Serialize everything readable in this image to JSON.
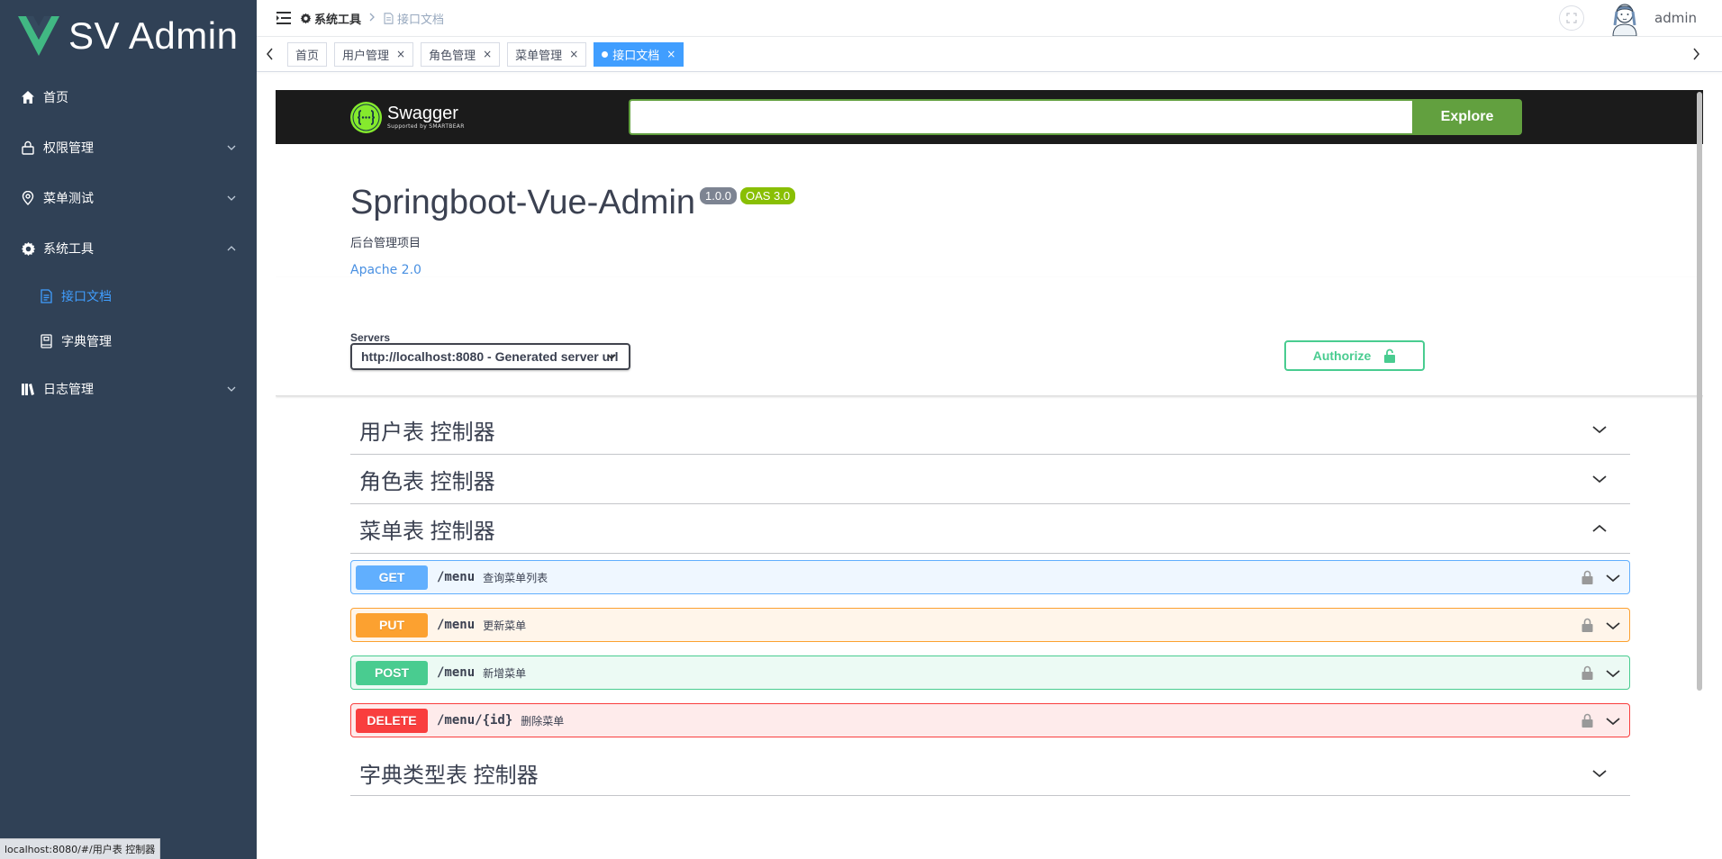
{
  "sidebar": {
    "logo_text": "SV Admin",
    "items": [
      {
        "label": "首页",
        "icon": "home-icon"
      },
      {
        "label": "权限管理",
        "icon": "lock-icon",
        "expanded": false
      },
      {
        "label": "菜单测试",
        "icon": "location-icon",
        "expanded": false
      },
      {
        "label": "系统工具",
        "icon": "gear-icon",
        "expanded": true
      },
      {
        "label": "接口文档",
        "icon": "document-icon",
        "active": true
      },
      {
        "label": "字典管理",
        "icon": "notebook-icon"
      },
      {
        "label": "日志管理",
        "icon": "books-icon",
        "expanded": false
      }
    ],
    "active_color": "#409eff",
    "bg_color": "#304156"
  },
  "status_bar": {
    "url": "localhost:8080/#/用户表 控制器"
  },
  "navbar": {
    "breadcrumb": [
      {
        "label": "系统工具",
        "icon": "gear-icon"
      },
      {
        "label": "接口文档",
        "icon": "document-icon"
      }
    ],
    "user_name": "admin"
  },
  "tags": [
    {
      "label": "首页",
      "closable": false
    },
    {
      "label": "用户管理",
      "closable": true
    },
    {
      "label": "角色管理",
      "closable": true
    },
    {
      "label": "菜单管理",
      "closable": true
    },
    {
      "label": "接口文档",
      "closable": true,
      "active": true
    }
  ],
  "close_glyph": "×",
  "swagger": {
    "brand": "Swagger",
    "brand_sub": "Supported by SMARTBEAR",
    "search_value": "",
    "explore_label": "Explore",
    "title": "Springboot-Vue-Admin",
    "version": "1.0.0",
    "oas": "OAS 3.0",
    "description": "后台管理项目",
    "license": "Apache 2.0",
    "servers_label": "Servers",
    "server_selected": "http://localhost:8080 - Generated server url",
    "authorize_label": "Authorize",
    "tag_groups": [
      {
        "name": "用户表 控制器",
        "expanded": false,
        "operations": []
      },
      {
        "name": "角色表 控制器",
        "expanded": false,
        "operations": []
      },
      {
        "name": "菜单表 控制器",
        "expanded": true,
        "operations": [
          {
            "method": "GET",
            "path": "/menu",
            "summary": "查询菜单列表"
          },
          {
            "method": "PUT",
            "path": "/menu",
            "summary": "更新菜单"
          },
          {
            "method": "POST",
            "path": "/menu",
            "summary": "新增菜单"
          },
          {
            "method": "DELETE",
            "path": "/menu/{id}",
            "summary": "删除菜单"
          }
        ]
      },
      {
        "name": "字典类型表 控制器",
        "expanded": false,
        "operations": []
      }
    ],
    "colors": {
      "get": "#61affe",
      "put": "#fca130",
      "post": "#49cc90",
      "delete": "#f93e3e",
      "brand_green": "#62a03f"
    }
  }
}
